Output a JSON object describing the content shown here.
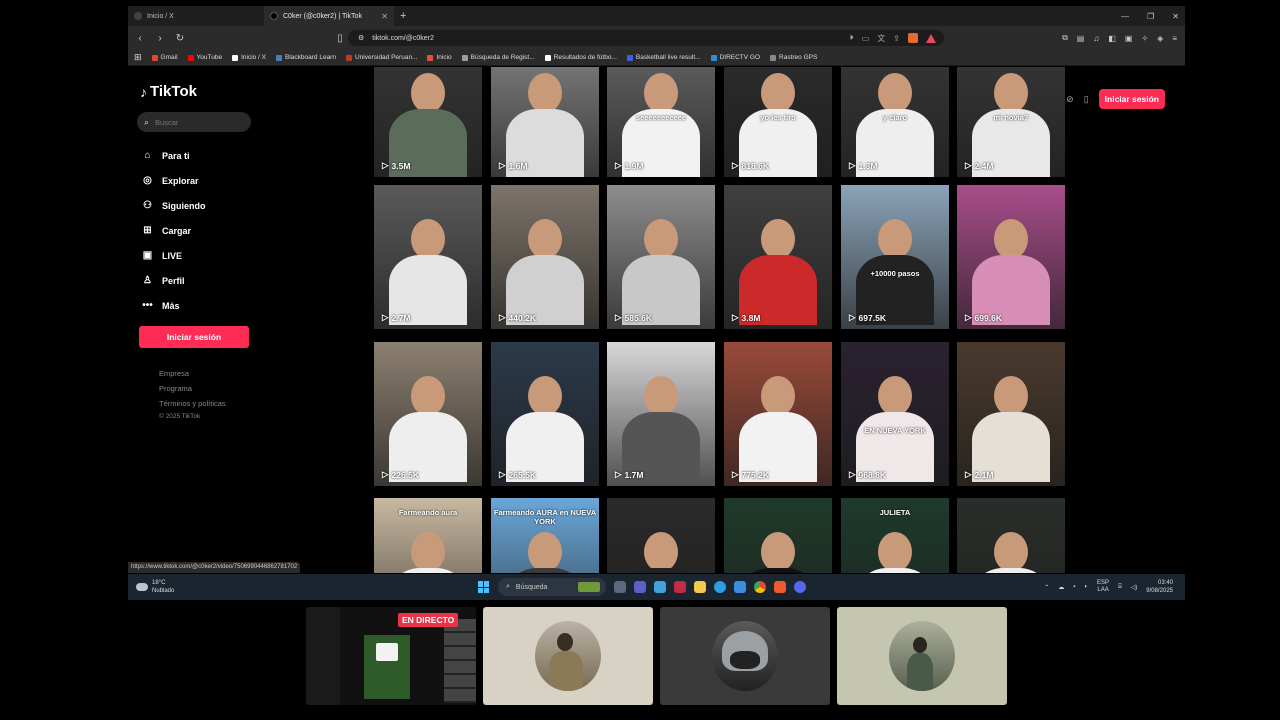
{
  "browser": {
    "tabs": [
      {
        "title": "Inicio / X",
        "active": false
      },
      {
        "title": "C0ker (@c0ker2) | TikTok",
        "active": true
      }
    ],
    "url": "tiktok.com/@c0ker2",
    "bookmarks": [
      {
        "label": "Gmail",
        "color": "#ea4335"
      },
      {
        "label": "YouTube",
        "color": "#ff0000"
      },
      {
        "label": "Inicio / X",
        "color": "#ffffff"
      },
      {
        "label": "Blackboard Learn",
        "color": "#4a7dbf"
      },
      {
        "label": "Universidad Peruan...",
        "color": "#c0392b"
      },
      {
        "label": "Inicio",
        "color": "#e74c3c"
      },
      {
        "label": "Búsqueda de Regist...",
        "color": "#9b9b9b"
      },
      {
        "label": "Resultados de fútbo...",
        "color": "#ffffff"
      },
      {
        "label": "Basketball live result...",
        "color": "#3b5fe0"
      },
      {
        "label": "DIRECTV GO",
        "color": "#2b8fd6"
      },
      {
        "label": "Rastreo GPS",
        "color": "#888888"
      }
    ],
    "status_url": "https://www.tiktok.com/@c0ker2/video/7506990446862781702"
  },
  "tiktok": {
    "logo": "TikTok",
    "search_placeholder": "Buscar",
    "nav": [
      {
        "label": "Para ti",
        "icon": "home-icon",
        "glyph": "⌂"
      },
      {
        "label": "Explorar",
        "icon": "compass-icon",
        "glyph": "◎"
      },
      {
        "label": "Siguiendo",
        "icon": "following-icon",
        "glyph": "⚇"
      },
      {
        "label": "Cargar",
        "icon": "upload-icon",
        "glyph": "⊞"
      },
      {
        "label": "LIVE",
        "icon": "live-icon",
        "glyph": "▣"
      },
      {
        "label": "Perfil",
        "icon": "profile-icon",
        "glyph": "♙"
      },
      {
        "label": "Más",
        "icon": "more-icon",
        "glyph": "•••"
      }
    ],
    "login_label": "Iniciar sesión",
    "footer": [
      "Empresa",
      "Programa",
      "Términos y políticas"
    ],
    "copyright": "© 2025 TikTok",
    "top_login_label": "Iniciar sesión",
    "videos": [
      {
        "views": "3.5M",
        "caption": "",
        "bg": "#3a3a3a",
        "shirt": "#5b6b5c"
      },
      {
        "views": "1.6M",
        "caption": "",
        "bg": "#8a8a8a",
        "shirt": "#dcdcdc"
      },
      {
        "views": "1.9M",
        "caption": "seeeeeeeeeee",
        "bg": "#6a6a6a",
        "shirt": "#f2f2f2"
      },
      {
        "views": "818.6K",
        "caption": "yo les tiro",
        "bg": "#2e2e2e",
        "shirt": "#f0f0f0"
      },
      {
        "views": "1.3M",
        "caption": "y claro",
        "bg": "#3a3a3a",
        "shirt": "#eeeeee"
      },
      {
        "views": "2.4M",
        "caption": "mi novia?",
        "bg": "#3a3a3a",
        "shirt": "#e8e8e8"
      },
      {
        "views": "2.7M",
        "caption": "",
        "bg": "#5a5a5a",
        "shirt": "#e6e6e6"
      },
      {
        "views": "440.2K",
        "caption": "",
        "bg": "#7d746a",
        "shirt": "#d0d0d0"
      },
      {
        "views": "585.6K",
        "caption": "",
        "bg": "#8d8d8d",
        "shirt": "#c8c8c8"
      },
      {
        "views": "3.8M",
        "caption": "",
        "bg": "#3f3f3f",
        "shirt": "#cc2a2a"
      },
      {
        "views": "697.5K",
        "caption": "+10000 pasos",
        "bg": "#8aa3b8",
        "shirt": "#222222"
      },
      {
        "views": "699.6K",
        "caption": "",
        "bg": "#a84d8a",
        "shirt": "#d88fb7"
      },
      {
        "views": "226.5K",
        "caption": "",
        "bg": "#8c8070",
        "shirt": "#eeeeee"
      },
      {
        "views": "265.5K",
        "caption": "",
        "bg": "#2c3a4a",
        "shirt": "#f0f0f0"
      },
      {
        "views": "1.7M",
        "caption": "",
        "bg": "#d8d8d8",
        "shirt": "#555555"
      },
      {
        "views": "775.2K",
        "caption": "",
        "bg": "#9a4a3a",
        "shirt": "#f2f2f2"
      },
      {
        "views": "968.8K",
        "caption": "EN NUEVA YORK",
        "bg": "#2a2230",
        "shirt": "#f0e8e8"
      },
      {
        "views": "2.1M",
        "caption": "",
        "bg": "#4a3a2e",
        "shirt": "#e4e0d6"
      },
      {
        "views": "",
        "caption": "Farmeando aura",
        "bg": "#c8b8a0",
        "shirt": "#f0f0f0"
      },
      {
        "views": "",
        "caption": "Farmeando AURA en NUEVA YORK",
        "bg": "#6aa7d8",
        "shirt": "#3a3a3a"
      },
      {
        "views": "",
        "caption": "",
        "bg": "#2a2a2a",
        "shirt": "#222222"
      },
      {
        "views": "",
        "caption": "",
        "bg": "#1f3a2a",
        "shirt": "#111111"
      },
      {
        "views": "",
        "caption": "JULIETA",
        "bg": "#1e3a2c",
        "shirt": "#f0f0f0"
      },
      {
        "views": "",
        "caption": "",
        "bg": "#2a2e2a",
        "shirt": "#eeeeee"
      }
    ]
  },
  "taskbar": {
    "weather_temp": "18°C",
    "weather_desc": "Nublado",
    "search_label": "Búsqueda",
    "lang_top": "ESP",
    "lang_bottom": "LAA",
    "time": "03:40",
    "date": "9/08/2025"
  },
  "stream": {
    "live_label": "EN DIRECTO"
  }
}
